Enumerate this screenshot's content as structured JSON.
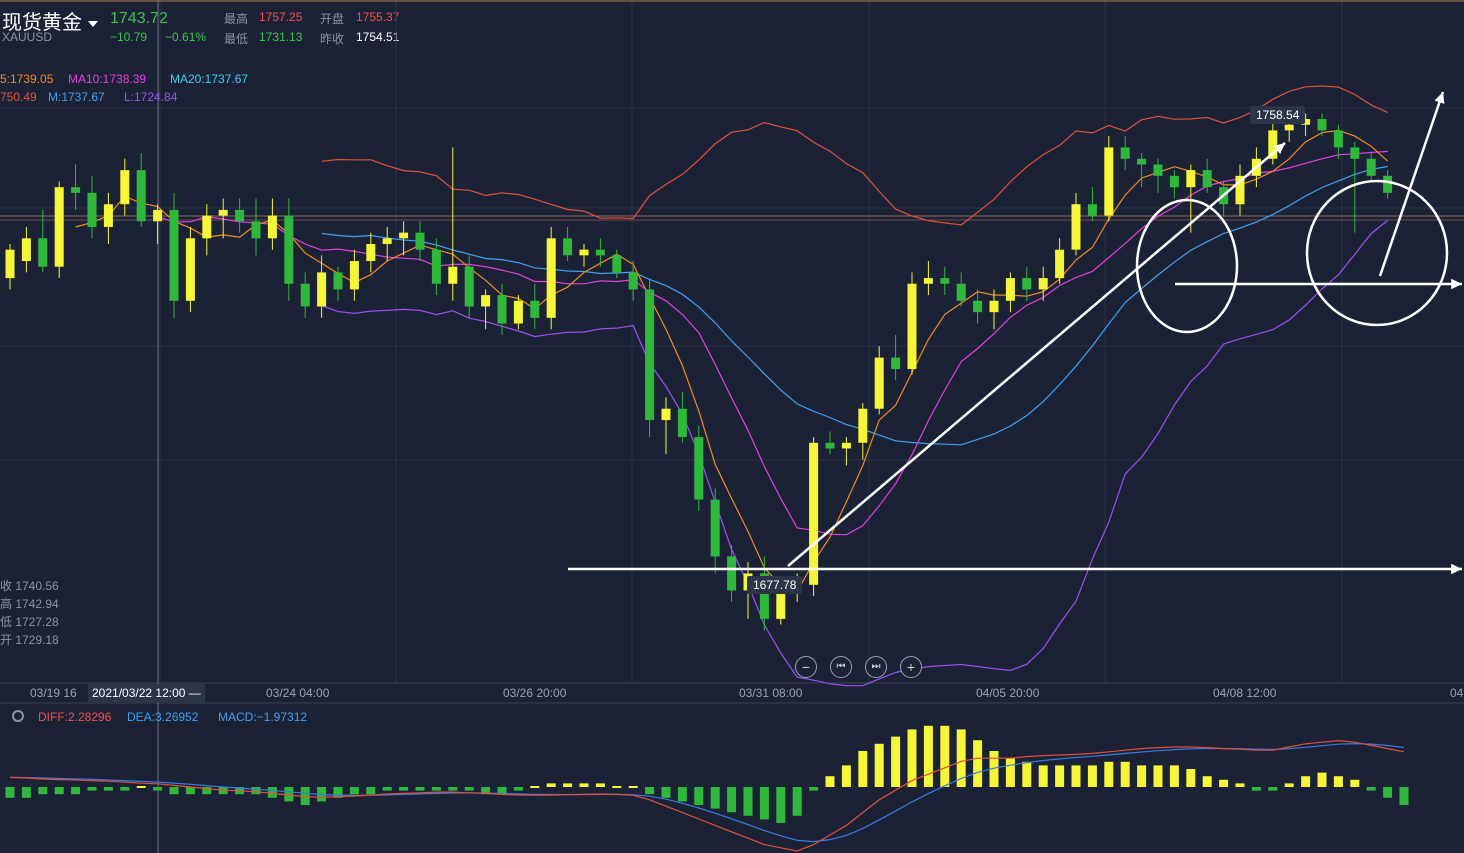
{
  "header": {
    "name": "现货黄金",
    "symbol": "XAUUSD",
    "price": "1743.72",
    "change": "−10.79",
    "change_pct": "−0.61%",
    "high_label": "最高",
    "high": "1757.25",
    "open_label": "开盘",
    "open": "1755.37",
    "low_label": "最低",
    "low": "1731.13",
    "prev_label": "昨收",
    "prev_close": "1754.51"
  },
  "indicators": {
    "ma5": "5:1739.05",
    "ma10": "MA10:1738.39",
    "ma20": "MA20:1737.67",
    "bb_upper": "750.49",
    "bb_mid": "M:1737.67",
    "bb_lower": "L:1724.84"
  },
  "side_info": [
    "收 1740.56",
    "高 1742.94",
    "低 1727.28",
    "开 1729.18"
  ],
  "nav_buttons": {
    "zoom_out": "−",
    "prev": "⏮",
    "next": "⏭",
    "zoom_in": "+"
  },
  "xaxis": {
    "selected": "2021/03/22 12:00 —",
    "labels": [
      "03/19 16",
      "03/24 04:00",
      "03/26 20:00",
      "03/31 08:00",
      "04/05 20:00",
      "04/08 12:00",
      "04"
    ]
  },
  "macd": {
    "diff": "DIFF:2.28296",
    "dea": "DEA:3.26952",
    "macd": "MACD:−1.97312"
  },
  "colors": {
    "up": "#f5f53a",
    "down": "#30b83c",
    "ma5": "#f08a24",
    "ma10": "#e040e0",
    "ma20": "#3fa0f0",
    "bb": "#e0503a",
    "lower": "#9a50f0"
  },
  "chart_data": {
    "type": "candlestick",
    "annotations": {
      "high_tag": "1758.54",
      "low_tag": "1677.78"
    },
    "candles": [
      {
        "o": 1729,
        "h": 1735,
        "l": 1727,
        "c": 1734
      },
      {
        "o": 1732,
        "h": 1738,
        "l": 1730,
        "c": 1736
      },
      {
        "o": 1736,
        "h": 1741,
        "l": 1730,
        "c": 1731
      },
      {
        "o": 1731,
        "h": 1746,
        "l": 1729,
        "c": 1745
      },
      {
        "o": 1745,
        "h": 1749,
        "l": 1741,
        "c": 1744
      },
      {
        "o": 1744,
        "h": 1747,
        "l": 1736,
        "c": 1738
      },
      {
        "o": 1738,
        "h": 1744,
        "l": 1735,
        "c": 1742
      },
      {
        "o": 1742,
        "h": 1750,
        "l": 1740,
        "c": 1748
      },
      {
        "o": 1748,
        "h": 1751,
        "l": 1738,
        "c": 1739
      },
      {
        "o": 1739,
        "h": 1742,
        "l": 1735,
        "c": 1741
      },
      {
        "o": 1741,
        "h": 1744,
        "l": 1722,
        "c": 1725
      },
      {
        "o": 1725,
        "h": 1738,
        "l": 1723,
        "c": 1736
      },
      {
        "o": 1736,
        "h": 1742,
        "l": 1733,
        "c": 1740
      },
      {
        "o": 1740,
        "h": 1743,
        "l": 1736,
        "c": 1741
      },
      {
        "o": 1741,
        "h": 1743,
        "l": 1737,
        "c": 1739
      },
      {
        "o": 1739,
        "h": 1743,
        "l": 1733,
        "c": 1736
      },
      {
        "o": 1736,
        "h": 1743,
        "l": 1734,
        "c": 1740
      },
      {
        "o": 1740,
        "h": 1743,
        "l": 1725,
        "c": 1728
      },
      {
        "o": 1728,
        "h": 1730,
        "l": 1722,
        "c": 1724
      },
      {
        "o": 1724,
        "h": 1733,
        "l": 1722,
        "c": 1730
      },
      {
        "o": 1730,
        "h": 1731,
        "l": 1725,
        "c": 1727
      },
      {
        "o": 1727,
        "h": 1734,
        "l": 1725,
        "c": 1732
      },
      {
        "o": 1732,
        "h": 1737,
        "l": 1730,
        "c": 1735
      },
      {
        "o": 1735,
        "h": 1738,
        "l": 1732,
        "c": 1736
      },
      {
        "o": 1736,
        "h": 1739,
        "l": 1733,
        "c": 1737
      },
      {
        "o": 1737,
        "h": 1739,
        "l": 1732,
        "c": 1734
      },
      {
        "o": 1734,
        "h": 1736,
        "l": 1726,
        "c": 1728
      },
      {
        "o": 1728,
        "h": 1752,
        "l": 1725,
        "c": 1731
      },
      {
        "o": 1731,
        "h": 1733,
        "l": 1722,
        "c": 1724
      },
      {
        "o": 1724,
        "h": 1727,
        "l": 1720,
        "c": 1726
      },
      {
        "o": 1726,
        "h": 1728,
        "l": 1719,
        "c": 1721
      },
      {
        "o": 1721,
        "h": 1726,
        "l": 1720,
        "c": 1725
      },
      {
        "o": 1725,
        "h": 1728,
        "l": 1720,
        "c": 1722
      },
      {
        "o": 1722,
        "h": 1738,
        "l": 1720,
        "c": 1736
      },
      {
        "o": 1736,
        "h": 1738,
        "l": 1732,
        "c": 1733
      },
      {
        "o": 1733,
        "h": 1735,
        "l": 1731,
        "c": 1734
      },
      {
        "o": 1734,
        "h": 1736,
        "l": 1731,
        "c": 1733
      },
      {
        "o": 1733,
        "h": 1734,
        "l": 1729,
        "c": 1730
      },
      {
        "o": 1730,
        "h": 1732,
        "l": 1725,
        "c": 1727
      },
      {
        "o": 1727,
        "h": 1729,
        "l": 1701,
        "c": 1704
      },
      {
        "o": 1704,
        "h": 1708,
        "l": 1698,
        "c": 1706
      },
      {
        "o": 1706,
        "h": 1709,
        "l": 1700,
        "c": 1701
      },
      {
        "o": 1701,
        "h": 1703,
        "l": 1688,
        "c": 1690
      },
      {
        "o": 1690,
        "h": 1692,
        "l": 1677,
        "c": 1680
      },
      {
        "o": 1680,
        "h": 1682,
        "l": 1672,
        "c": 1674
      },
      {
        "o": 1674,
        "h": 1679,
        "l": 1669,
        "c": 1677
      },
      {
        "o": 1677,
        "h": 1680,
        "l": 1667,
        "c": 1669
      },
      {
        "o": 1669,
        "h": 1675,
        "l": 1668,
        "c": 1674
      },
      {
        "o": 1674,
        "h": 1677,
        "l": 1672,
        "c": 1675
      },
      {
        "o": 1675,
        "h": 1701,
        "l": 1673,
        "c": 1700
      },
      {
        "o": 1700,
        "h": 1702,
        "l": 1698,
        "c": 1699
      },
      {
        "o": 1699,
        "h": 1701,
        "l": 1696,
        "c": 1700
      },
      {
        "o": 1700,
        "h": 1707,
        "l": 1697,
        "c": 1706
      },
      {
        "o": 1706,
        "h": 1717,
        "l": 1705,
        "c": 1715
      },
      {
        "o": 1715,
        "h": 1719,
        "l": 1711,
        "c": 1713
      },
      {
        "o": 1713,
        "h": 1730,
        "l": 1712,
        "c": 1728
      },
      {
        "o": 1728,
        "h": 1732,
        "l": 1726,
        "c": 1729
      },
      {
        "o": 1729,
        "h": 1731,
        "l": 1726,
        "c": 1728
      },
      {
        "o": 1728,
        "h": 1730,
        "l": 1724,
        "c": 1725
      },
      {
        "o": 1725,
        "h": 1727,
        "l": 1721,
        "c": 1723
      },
      {
        "o": 1723,
        "h": 1727,
        "l": 1720,
        "c": 1725
      },
      {
        "o": 1725,
        "h": 1730,
        "l": 1723,
        "c": 1729
      },
      {
        "o": 1729,
        "h": 1731,
        "l": 1725,
        "c": 1727
      },
      {
        "o": 1727,
        "h": 1731,
        "l": 1725,
        "c": 1729
      },
      {
        "o": 1729,
        "h": 1736,
        "l": 1728,
        "c": 1734
      },
      {
        "o": 1734,
        "h": 1744,
        "l": 1733,
        "c": 1742
      },
      {
        "o": 1742,
        "h": 1745,
        "l": 1739,
        "c": 1740
      },
      {
        "o": 1740,
        "h": 1754,
        "l": 1739,
        "c": 1752
      },
      {
        "o": 1752,
        "h": 1754,
        "l": 1748,
        "c": 1750
      },
      {
        "o": 1750,
        "h": 1751,
        "l": 1745,
        "c": 1749
      },
      {
        "o": 1749,
        "h": 1750,
        "l": 1744,
        "c": 1747
      },
      {
        "o": 1747,
        "h": 1748,
        "l": 1743,
        "c": 1745
      },
      {
        "o": 1745,
        "h": 1749,
        "l": 1737,
        "c": 1748
      },
      {
        "o": 1748,
        "h": 1750,
        "l": 1744,
        "c": 1745
      },
      {
        "o": 1745,
        "h": 1746,
        "l": 1740,
        "c": 1742
      },
      {
        "o": 1742,
        "h": 1749,
        "l": 1740,
        "c": 1747
      },
      {
        "o": 1747,
        "h": 1752,
        "l": 1745,
        "c": 1750
      },
      {
        "o": 1750,
        "h": 1758,
        "l": 1749,
        "c": 1755
      },
      {
        "o": 1755,
        "h": 1758,
        "l": 1753,
        "c": 1756
      },
      {
        "o": 1756,
        "h": 1758,
        "l": 1754,
        "c": 1757
      },
      {
        "o": 1757,
        "h": 1758,
        "l": 1754,
        "c": 1755
      },
      {
        "o": 1755,
        "h": 1756,
        "l": 1750,
        "c": 1752
      },
      {
        "o": 1752,
        "h": 1753,
        "l": 1737,
        "c": 1750
      },
      {
        "o": 1750,
        "h": 1751,
        "l": 1746,
        "c": 1747
      },
      {
        "o": 1747,
        "h": 1748,
        "l": 1743,
        "c": 1744
      }
    ],
    "macd_hist": [
      -3,
      -3,
      -2,
      -2,
      -2,
      -1,
      -1,
      -1,
      0,
      -1,
      -2,
      -2,
      -2,
      -2,
      -2,
      -2,
      -3,
      -4,
      -5,
      -4,
      -3,
      -2,
      -2,
      -1,
      -1,
      -1,
      -1,
      -1,
      -1,
      -2,
      -2,
      -1,
      0,
      1,
      1,
      1,
      1,
      0,
      0,
      -2,
      -3,
      -4,
      -5,
      -6,
      -7,
      -8,
      -9,
      -10,
      -8,
      -1,
      3,
      6,
      10,
      12,
      14,
      16,
      17,
      17,
      16,
      13,
      10,
      8,
      7,
      6,
      6,
      6,
      6,
      7,
      7,
      6,
      6,
      6,
      5,
      3,
      2,
      1,
      -1,
      -1,
      1,
      3,
      4,
      3,
      2,
      -1,
      -3,
      -5
    ],
    "macd_diff": [
      3,
      2.8,
      2.5,
      2.3,
      2.2,
      2,
      1.8,
      1.5,
      1.2,
      1,
      0.5,
      0,
      -0.5,
      -1,
      -1.2,
      -1.5,
      -2,
      -2.5,
      -3,
      -3.2,
      -3,
      -2.8,
      -2.5,
      -2.2,
      -2,
      -1.8,
      -1.6,
      -1.6,
      -1.8,
      -2,
      -2.3,
      -2.5,
      -2.6,
      -2.5,
      -2.4,
      -2.3,
      -2.2,
      -2.3,
      -2.6,
      -4,
      -6,
      -8,
      -10,
      -12,
      -14,
      -16,
      -18,
      -19,
      -20,
      -18,
      -15,
      -12,
      -8,
      -4,
      -1,
      2,
      4,
      6,
      8,
      9,
      9,
      9,
      9.5,
      9.8,
      10,
      10.2,
      10.5,
      11,
      11.5,
      12,
      12.3,
      12.5,
      12.5,
      12.3,
      12,
      11.8,
      11.5,
      11.5,
      12.5,
      13.5,
      14,
      14.5,
      14,
      13,
      12,
      11
    ]
  }
}
